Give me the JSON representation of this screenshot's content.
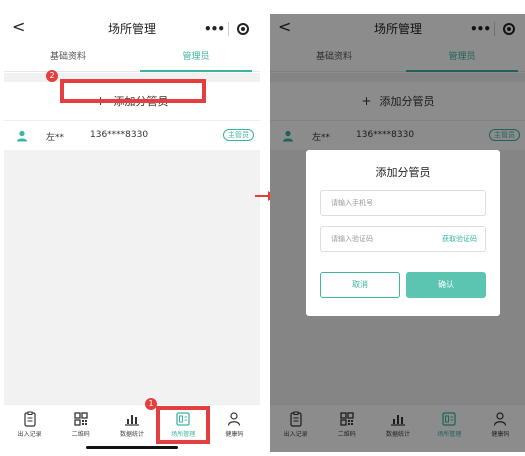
{
  "navbar": {
    "back": "<",
    "title": "场所管理",
    "dots": "•••"
  },
  "tabs": [
    "基础资料",
    "管理员"
  ],
  "add": {
    "plus": "+",
    "label": "添加分管员"
  },
  "user": {
    "name": "左**",
    "phone": "136****8330",
    "badge": "主管员"
  },
  "tabbar": [
    "出入记录",
    "二维码",
    "数据统计",
    "场所管理",
    "健康码"
  ],
  "markers": [
    "2",
    "1"
  ],
  "dialog": {
    "title": "添加分管员",
    "phone_placeholder": "请输入手机号",
    "code_placeholder": "请输入验证码",
    "get_code": "获取验证码",
    "cancel": "取消",
    "confirm": "确认"
  },
  "colors": {
    "accent": "#39b5a0",
    "highlight": "#e53e3e"
  },
  "active_tab_index": 3
}
